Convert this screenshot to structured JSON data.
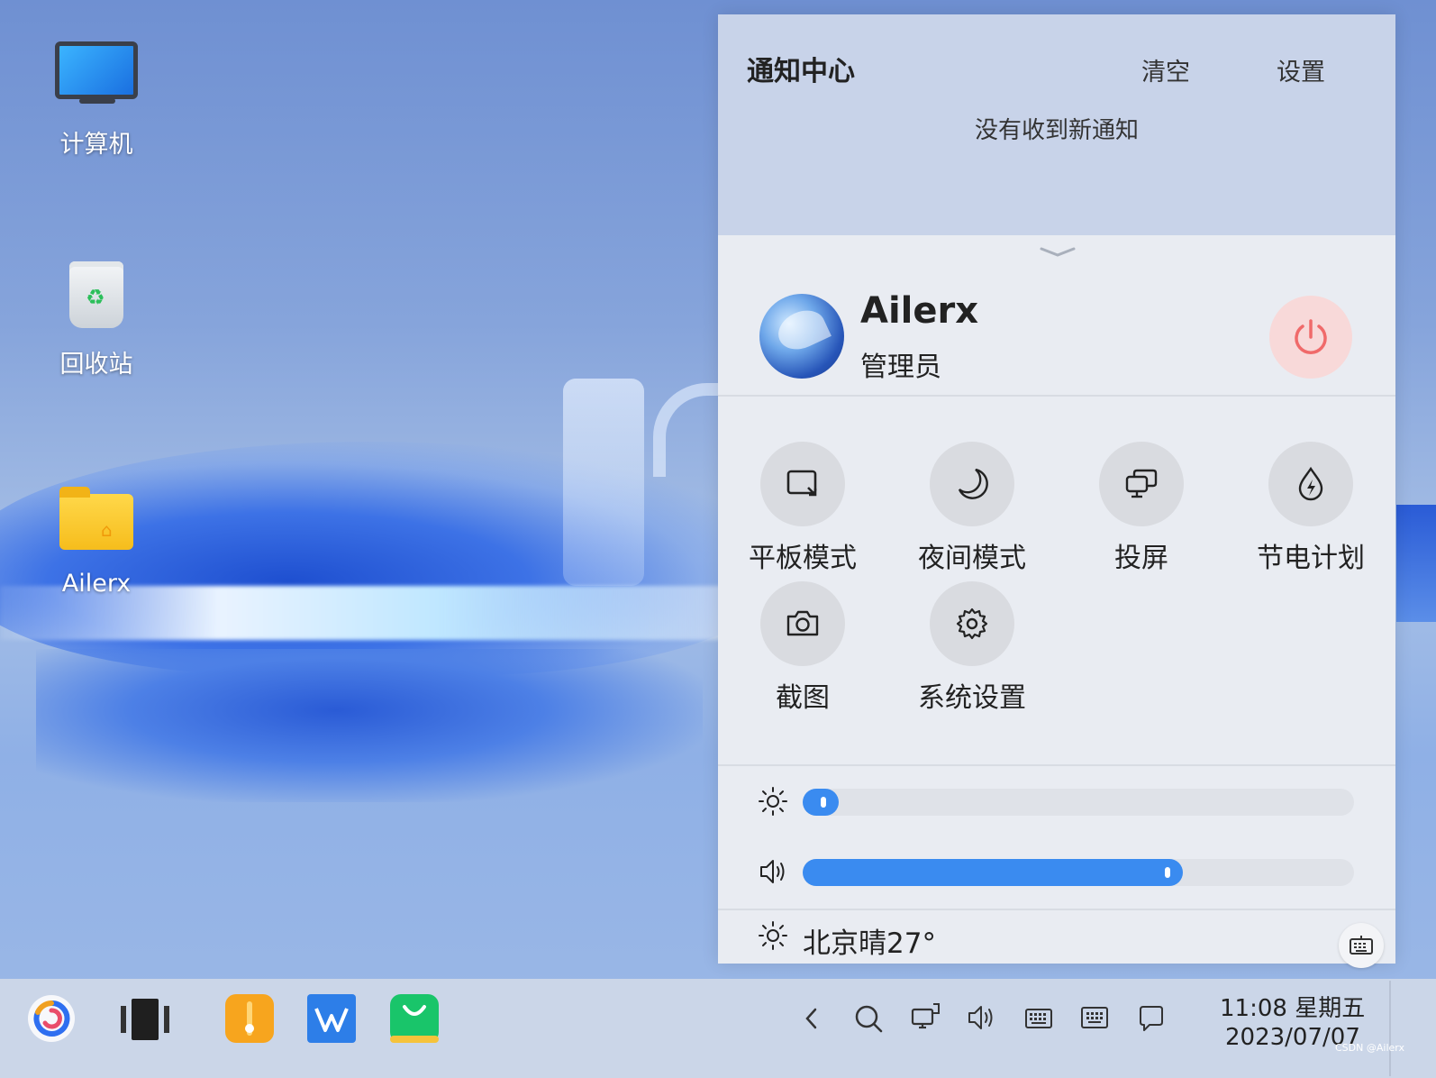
{
  "desktop": {
    "icons": [
      {
        "label": "计算机",
        "icon": "computer-icon"
      },
      {
        "label": "回收站",
        "icon": "trash-icon"
      },
      {
        "label": "Ailerx",
        "icon": "home-folder-icon"
      }
    ]
  },
  "notification_center": {
    "title": "通知中心",
    "clear_label": "清空",
    "settings_label": "设置",
    "empty_message": "没有收到新通知"
  },
  "user": {
    "name": "Ailerx",
    "role": "管理员"
  },
  "quick_settings": [
    {
      "label": "平板模式",
      "icon": "tablet-mode-icon"
    },
    {
      "label": "夜间模式",
      "icon": "night-mode-icon"
    },
    {
      "label": "投屏",
      "icon": "screen-cast-icon"
    },
    {
      "label": "节电计划",
      "icon": "power-saving-icon"
    },
    {
      "label": "截图",
      "icon": "screenshot-icon"
    },
    {
      "label": "系统设置",
      "icon": "settings-gear-icon"
    }
  ],
  "sliders": {
    "brightness": 0.0,
    "volume": 0.69
  },
  "weather": {
    "text": "北京晴27°"
  },
  "taskbar": {
    "apps": [
      "start-menu-icon",
      "multitask-view-icon",
      "file-manager-icon",
      "wps-office-icon",
      "app-store-icon"
    ],
    "tray": [
      "chevron-left-icon",
      "search-icon",
      "network-icon",
      "volume-icon",
      "input-method-icon",
      "keyboard-icon",
      "notification-icon"
    ],
    "time": "11:08 星期五",
    "date": "2023/07/07"
  },
  "watermark": "CSDN @Ailerx",
  "colors": {
    "accent": "#3a8bf0",
    "power_bg": "#f8d9d9",
    "power_icon": "#f06a6a"
  }
}
